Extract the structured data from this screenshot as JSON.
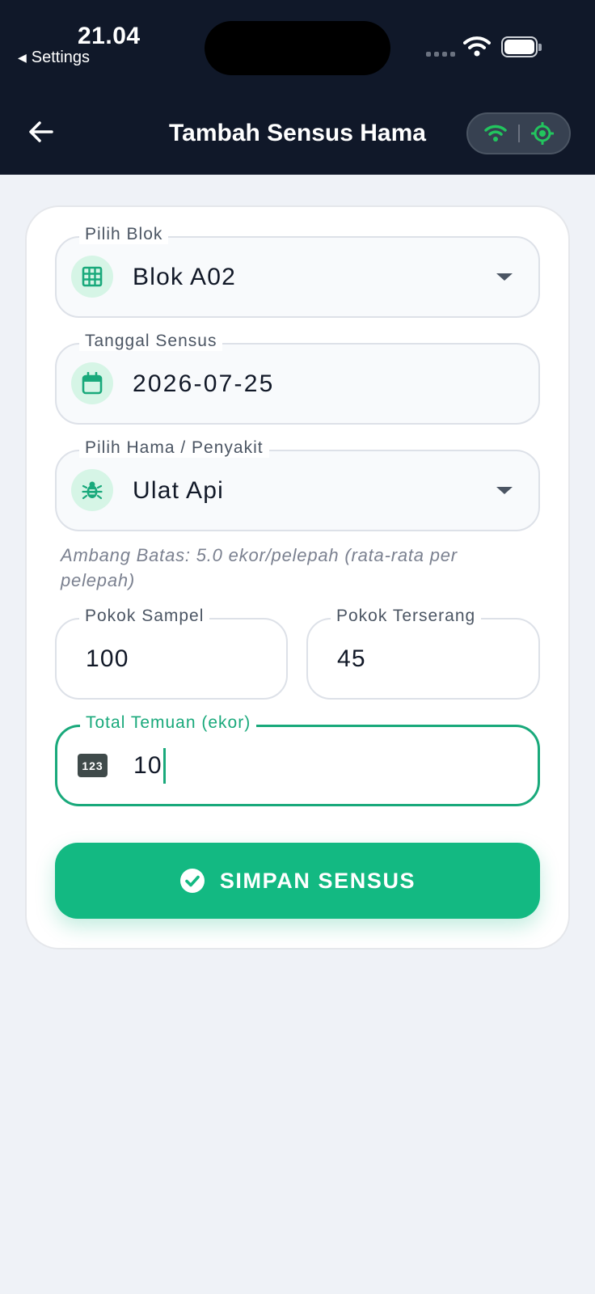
{
  "status_bar": {
    "time": "21.04",
    "back_label": "Settings"
  },
  "header": {
    "title": "Tambah Sensus Hama"
  },
  "form": {
    "block": {
      "label": "Pilih Blok",
      "value": "Blok A02"
    },
    "date": {
      "label": "Tanggal Sensus",
      "value": "2026-07-25"
    },
    "pest": {
      "label": "Pilih Hama / Penyakit",
      "value": "Ulat Api"
    },
    "threshold_hint": "Ambang Batas: 5.0 ekor/pelepah (rata-rata per pelepah)",
    "sample_trees": {
      "label": "Pokok Sampel",
      "value": "100"
    },
    "attacked_trees": {
      "label": "Pokok Terserang",
      "value": "45"
    },
    "total_findings": {
      "label": "Total Temuan (ekor)",
      "value": "10",
      "icon_text": "123"
    },
    "submit_label": "SIMPAN SENSUS"
  },
  "colors": {
    "header_bg": "#101829",
    "accent": "#13b982",
    "page_bg": "#eff2f7"
  },
  "icons": {
    "back": "arrow-left-icon",
    "wifi": "wifi-icon",
    "gps": "gps-target-icon",
    "block": "grid-icon",
    "date": "calendar-icon",
    "pest": "bug-icon",
    "submit": "check-circle-icon"
  }
}
